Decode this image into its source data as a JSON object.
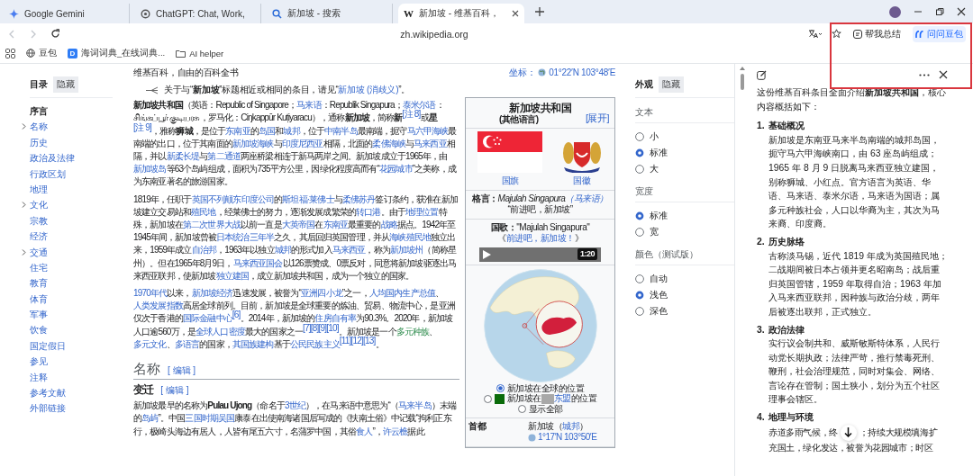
{
  "browser": {
    "tabs": [
      {
        "kind": "gemini",
        "title": "Google Gemini",
        "selected": false
      },
      {
        "kind": "chatgpt",
        "title": "ChatGPT: Chat, Work,",
        "selected": false
      },
      {
        "kind": "search",
        "title": "新加坡 - 搜索",
        "selected": false
      },
      {
        "kind": "wiki",
        "favicon": "W",
        "title": "新加坡 - 维基百科，",
        "selected": true
      }
    ],
    "nav": [
      {
        "kind": "back",
        "disabled": true
      },
      {
        "kind": "forward",
        "disabled": true
      },
      {
        "kind": "reload",
        "disabled": false
      }
    ],
    "address": "zh.wikipedia.org",
    "actions": [
      {
        "kind": "translate"
      },
      {
        "kind": "star"
      },
      {
        "kind": "summary",
        "label": "帮我总结"
      },
      {
        "kind": "ask",
        "label": "问问豆包"
      }
    ],
    "bookmarks": [
      {
        "kind": "apps"
      },
      {
        "kind": "globe",
        "label": "豆包"
      },
      {
        "kind": "dict",
        "favicon": "D",
        "label": "海词词典_在线词典..."
      },
      {
        "kind": "folder",
        "label": "AI helper"
      }
    ]
  },
  "toc": {
    "title": "目录",
    "hide_button": "隐藏",
    "items": [
      {
        "label": "序言",
        "expandable": false,
        "selected": true
      },
      {
        "label": "名称",
        "expandable": true,
        "selected": false
      },
      {
        "label": "历史",
        "expandable": false,
        "selected": false
      },
      {
        "label": "政治及法律",
        "expandable": false,
        "selected": false
      },
      {
        "label": "行政区划",
        "expandable": false,
        "selected": false
      },
      {
        "label": "地理",
        "expandable": false,
        "selected": false
      },
      {
        "label": "文化",
        "expandable": true,
        "selected": false
      },
      {
        "label": "宗教",
        "expandable": false,
        "selected": false
      },
      {
        "label": "经济",
        "expandable": false,
        "selected": false
      },
      {
        "label": "交通",
        "expandable": true,
        "selected": false
      },
      {
        "label": "住宅",
        "expandable": false,
        "selected": false
      },
      {
        "label": "教育",
        "expandable": false,
        "selected": false
      },
      {
        "label": "体育",
        "expandable": false,
        "selected": false
      },
      {
        "label": "军事",
        "expandable": false,
        "selected": false
      },
      {
        "label": "饮食",
        "expandable": false,
        "selected": false
      },
      {
        "label": "国定假日",
        "expandable": false,
        "selected": false
      },
      {
        "label": "参见",
        "expandable": false,
        "selected": false
      },
      {
        "label": "注释",
        "expandable": false,
        "selected": false
      },
      {
        "label": "参考文献",
        "expandable": false,
        "selected": false
      },
      {
        "label": "外部链接",
        "expandable": false,
        "selected": false
      }
    ]
  },
  "article": {
    "tagline": "维基百科，自由的百科全书",
    "coordinates_label": "坐标：",
    "coordinates": "01°22′N 103°48′E",
    "hatnote": [
      {
        "text": "关于与“",
        "kind": "t"
      },
      {
        "text": "新加坡",
        "kind": "b"
      },
      {
        "text": "”标题相近或相同的条目，请见“",
        "kind": "t"
      },
      {
        "text": "新加坡 (消歧义)",
        "kind": "l"
      },
      {
        "text": "”。",
        "kind": "t"
      }
    ],
    "intro": [
      [
        {
          "text": "新加坡共和国",
          "kind": "b"
        },
        {
          "text": "（英语：Republic of Singapore；",
          "kind": "t"
        },
        {
          "text": "马来语",
          "kind": "l"
        },
        {
          "text": "：Republik Singapura；",
          "kind": "t"
        },
        {
          "text": "泰米尔语",
          "kind": "l"
        },
        {
          "text": "：சிங்கப்பூர் குடியரசு，罗马化：Ciŋkappūr Kuṭiyaracu），通称",
          "kind": "t"
        },
        {
          "text": "新加坡",
          "kind": "b"
        },
        {
          "text": "，简称",
          "kind": "t"
        },
        {
          "text": "新",
          "kind": "b"
        },
        {
          "text": "[注 8]",
          "kind": "r"
        },
        {
          "text": "或",
          "kind": "t"
        },
        {
          "text": "星",
          "kind": "b"
        },
        {
          "text": "[注 9]",
          "kind": "r"
        },
        {
          "text": "，雅称",
          "kind": "t"
        },
        {
          "text": "狮城",
          "kind": "b"
        },
        {
          "text": "，是位于",
          "kind": "t"
        },
        {
          "text": "东南亚",
          "kind": "l"
        },
        {
          "text": "的",
          "kind": "t"
        },
        {
          "text": "岛国",
          "kind": "l"
        },
        {
          "text": "和",
          "kind": "t"
        },
        {
          "text": "城邦",
          "kind": "l"
        },
        {
          "text": "，位于",
          "kind": "t"
        },
        {
          "text": "中南半岛",
          "kind": "l"
        },
        {
          "text": "最南端，扼守",
          "kind": "t"
        },
        {
          "text": "马六甲海峡",
          "kind": "l"
        },
        {
          "text": "最南端的出口，位于其南面的",
          "kind": "t"
        },
        {
          "text": "新加坡海峡",
          "kind": "l"
        },
        {
          "text": "与",
          "kind": "t"
        },
        {
          "text": "印度尼西亚",
          "kind": "l"
        },
        {
          "text": "相隔，北面的",
          "kind": "t"
        },
        {
          "text": "柔佛海峡",
          "kind": "l"
        },
        {
          "text": "与",
          "kind": "t"
        },
        {
          "text": "马来西亚",
          "kind": "l"
        },
        {
          "text": "相隔，并以",
          "kind": "t"
        },
        {
          "text": "新柔长堤",
          "kind": "l"
        },
        {
          "text": "与",
          "kind": "t"
        },
        {
          "text": "第二通道",
          "kind": "l"
        },
        {
          "text": "两座桥梁相连于新马两岸之间。新加坡成立于1965年，由",
          "kind": "t"
        },
        {
          "text": "新加坡岛",
          "kind": "l"
        },
        {
          "text": "等63个岛屿组成，面积为735平方公里，因绿化程度高而有“",
          "kind": "t"
        },
        {
          "text": "花园城市",
          "kind": "l"
        },
        {
          "text": "”之美称，成为东南亚著名的旅游国家。",
          "kind": "t"
        }
      ],
      [
        {
          "text": "1819年，任职于",
          "kind": "t"
        },
        {
          "text": "英国不列颠东印度公司",
          "kind": "l"
        },
        {
          "text": "的",
          "kind": "t"
        },
        {
          "text": "斯坦福·莱佛士",
          "kind": "l"
        },
        {
          "text": "与",
          "kind": "t"
        },
        {
          "text": "柔佛苏丹",
          "kind": "l"
        },
        {
          "text": "签订条约，获准在新加坡建立交易站和",
          "kind": "t"
        },
        {
          "text": "殖民地",
          "kind": "l"
        },
        {
          "text": "，经莱佛士的努力，逐渐发展成繁荣的",
          "kind": "t"
        },
        {
          "text": "转口港",
          "kind": "l"
        },
        {
          "text": "。由于",
          "kind": "t"
        },
        {
          "text": "地理位置",
          "kind": "l"
        },
        {
          "text": "特殊，新加坡在",
          "kind": "t"
        },
        {
          "text": "第二次世界大战",
          "kind": "l"
        },
        {
          "text": "以前一直是",
          "kind": "t"
        },
        {
          "text": "大英帝国",
          "kind": "l"
        },
        {
          "text": "在",
          "kind": "t"
        },
        {
          "text": "东南亚",
          "kind": "l"
        },
        {
          "text": "最重要的",
          "kind": "t"
        },
        {
          "text": "战略",
          "kind": "l"
        },
        {
          "text": "据点。1942年至1945年间，新加坡曾被",
          "kind": "t"
        },
        {
          "text": "日本统治三年半",
          "kind": "l"
        },
        {
          "text": "之久，其后回归英国管理，并从",
          "kind": "t"
        },
        {
          "text": "海峡殖民地",
          "kind": "l"
        },
        {
          "text": "独立出来，1959年成立",
          "kind": "t"
        },
        {
          "text": "自治邦",
          "kind": "l"
        },
        {
          "text": "，1963年以独立",
          "kind": "t"
        },
        {
          "text": "城邦",
          "kind": "l"
        },
        {
          "text": "的形式加入",
          "kind": "t"
        },
        {
          "text": "马来西亚",
          "kind": "l"
        },
        {
          "text": "，称为",
          "kind": "t"
        },
        {
          "text": "新加坡州",
          "kind": "l"
        },
        {
          "text": "（简称星州）。但在1965年8月9日，",
          "kind": "t"
        },
        {
          "text": "马来西亚国会",
          "kind": "l"
        },
        {
          "text": "以126票赞成、0票反对，同意将新加坡驱逐出马来西亚联邦，使新加坡",
          "kind": "t"
        },
        {
          "text": "独立建国",
          "kind": "l"
        },
        {
          "text": "，成立新加坡共和国，成为一个独立的国家。",
          "kind": "t"
        }
      ],
      [
        {
          "text": "1970年代",
          "kind": "l"
        },
        {
          "text": "以来，",
          "kind": "t"
        },
        {
          "text": "新加坡经济",
          "kind": "l"
        },
        {
          "text": "迅速发展，被誉为“",
          "kind": "t"
        },
        {
          "text": "亚洲四小龙",
          "kind": "l"
        },
        {
          "text": "”之一，",
          "kind": "t"
        },
        {
          "text": "人均国内生产总值",
          "kind": "l"
        },
        {
          "text": "、",
          "kind": "t"
        },
        {
          "text": "人类发展指数",
          "kind": "l"
        },
        {
          "text": "高居全球前列。目前，新加坡是全球重要的炼油、贸易、物流中心，是亚洲仅次于香港的",
          "kind": "t"
        },
        {
          "text": "国际金融中心",
          "kind": "l"
        },
        {
          "text": "[6]",
          "kind": "r"
        },
        {
          "text": "。2014年，新加坡的",
          "kind": "t"
        },
        {
          "text": "住房自有率",
          "kind": "l"
        },
        {
          "text": "为90.3%。2020年，新加坡人口逾560万，是",
          "kind": "t"
        },
        {
          "text": "全球人口密度",
          "kind": "l"
        },
        {
          "text": "最大的国家之一",
          "kind": "t"
        },
        {
          "text": "[7][8][9][10]",
          "kind": "r"
        },
        {
          "text": "。新加坡是一个",
          "kind": "t"
        },
        {
          "text": "多元种族",
          "kind": "g"
        },
        {
          "text": "、",
          "kind": "t"
        },
        {
          "text": "多元文化",
          "kind": "l"
        },
        {
          "text": "、",
          "kind": "t"
        },
        {
          "text": "多语言",
          "kind": "l"
        },
        {
          "text": "的国家，",
          "kind": "t"
        },
        {
          "text": "其国族建构",
          "kind": "l"
        },
        {
          "text": "基于",
          "kind": "t"
        },
        {
          "text": "公民民族主义",
          "kind": "l"
        },
        {
          "text": "[11][12][13]",
          "kind": "r"
        },
        {
          "text": "。",
          "kind": "t"
        }
      ]
    ],
    "section": {
      "heading": "名称",
      "edit": "[ 编辑 ]",
      "subheading": "变迁",
      "sub_edit": "[ 编辑 ]",
      "paragraph": [
        {
          "text": "新加坡最早的名称为",
          "kind": "t"
        },
        {
          "text": "Pulau Ujong",
          "kind": "b"
        },
        {
          "text": "（命名于",
          "kind": "t"
        },
        {
          "text": "3世纪",
          "kind": "l"
        },
        {
          "text": "），在马来语中意思为“（",
          "kind": "t"
        },
        {
          "text": "马来半岛",
          "kind": "l"
        },
        {
          "text": "）末端的",
          "kind": "t"
        },
        {
          "text": "岛屿",
          "kind": "l"
        },
        {
          "text": "”。中国",
          "kind": "t"
        },
        {
          "text": "三国时期吴国",
          "kind": "l"
        },
        {
          "text": "康泰在出使南海诸国后写成的《扶南土俗》中记载“拘利正东行，极崎头海边有居人，人皆有尾五六寸，名蒲罗中国，其俗",
          "kind": "t"
        },
        {
          "text": "食人",
          "kind": "l"
        },
        {
          "text": "”，",
          "kind": "t"
        },
        {
          "text": "许云樵",
          "kind": "l"
        },
        {
          "text": "据此",
          "kind": "t"
        }
      ]
    }
  },
  "infobox": {
    "title": "新加坡共和国",
    "subtitle": "(其他语言)",
    "toggle": "[展开]",
    "images": [
      {
        "kind": "flag",
        "label": "国旗"
      },
      {
        "kind": "emblem",
        "label": "国徽"
      }
    ],
    "motto": {
      "label": "格言：",
      "value": "Majulah Singapura",
      "lang": "（马来语）",
      "translation": "“前进吧，新加坡”"
    },
    "anthem": {
      "label": "国歌：",
      "value": "\"Majulah Singapura\"",
      "open": "《",
      "link": "前进吧，新加坡！",
      "close": "》",
      "duration": "1:20"
    },
    "map_options": [
      {
        "selected": true,
        "parts": [
          {
            "text": "新加坡在全球的位置",
            "kind": "t"
          }
        ]
      },
      {
        "selected": false,
        "kind": "legend",
        "color": "#0a6b0a",
        "parts": [
          {
            "text": "新加坡在",
            "kind": "t"
          },
          {
            "text": "东盟",
            "kind": "l"
          },
          {
            "text": "的位置",
            "kind": "t"
          }
        ]
      },
      {
        "selected": false,
        "parts": [
          {
            "text": "显示全部",
            "kind": "t"
          }
        ]
      }
    ],
    "capital": {
      "label": "首都",
      "value": "新加坡（",
      "link": "城邦",
      "close": "）",
      "coords": "1°17′N 103°50′E"
    }
  },
  "appearance": {
    "title": "外观",
    "hide_button": "隐藏",
    "groups": [
      {
        "label": "文本",
        "options": [
          {
            "label": "小",
            "selected": false
          },
          {
            "label": "标准",
            "selected": true
          },
          {
            "label": "大",
            "selected": false
          }
        ]
      },
      {
        "label": "宽度",
        "options": [
          {
            "label": "标准",
            "selected": true
          },
          {
            "label": "宽",
            "selected": false
          }
        ]
      },
      {
        "label": "颜色（测试版）",
        "options": [
          {
            "label": "自动",
            "selected": false
          },
          {
            "label": "浅色",
            "selected": true
          },
          {
            "label": "深色",
            "selected": false
          }
        ]
      }
    ]
  },
  "assistant": {
    "intro": "这份维基百科条目全面介绍**新加坡共和国**，核心内容概括如下：",
    "sections": [
      {
        "number": "1.",
        "title": "基础概况",
        "body": "新加坡是东南亚马来半岛南端的城邦岛国，扼守马六甲海峡南口，由 63 座岛屿组成；1965 年 8 月 9 日脱离马来西亚独立建国，别称狮城、小红点。官方语言为英语、华语、马来语、泰米尔语，马来语为国语；属多元种族社会，人口以华裔为主，其次为马来裔、印度裔。"
      },
      {
        "number": "2.",
        "title": "历史脉络",
        "body": "古称淡马锡，近代 1819 年成为英国殖民地；二战期间被日本占领并更名昭南岛；战后重归英国管辖，1959 年取得自治；1963 年加入马来西亚联邦，因种族与政治分歧，两年后被逐出联邦，正式独立。"
      },
      {
        "number": "3.",
        "title": "政治法律",
        "body": "实行议会制共和、威斯敏斯特体系，人民行动党长期执政；法律严苛，推行禁毒死刑、鞭刑，社会治理规范，同时对集会、网络、言论存在管制；国土狭小，划分为五个社区理事会辖区。"
      },
      {
        "number": "4.",
        "title": "地理与环境",
        "body": "赤道多雨气候，终",
        "body_after": "；持续大规模填海扩",
        "body_next": "充国土，绿化发达，被誉为花园城市；时区"
      }
    ]
  }
}
